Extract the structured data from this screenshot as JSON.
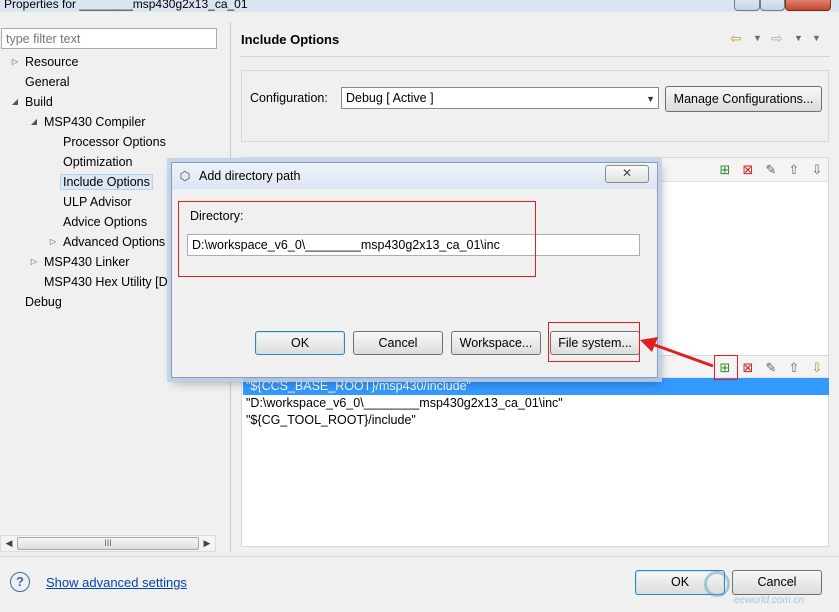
{
  "window": {
    "title": "Properties for ________msp430g2x13_ca_01"
  },
  "filter": {
    "placeholder": "type filter text"
  },
  "tree": {
    "items": [
      {
        "label": "Resource"
      },
      {
        "label": "General"
      },
      {
        "label": "Build"
      },
      {
        "label": "MSP430 Compiler"
      },
      {
        "label": "Processor Options"
      },
      {
        "label": "Optimization"
      },
      {
        "label": "Include Options"
      },
      {
        "label": "ULP Advisor"
      },
      {
        "label": "Advice Options"
      },
      {
        "label": "Advanced Options"
      },
      {
        "label": "MSP430 Linker"
      },
      {
        "label": "MSP430 Hex Utility  [D"
      },
      {
        "label": "Debug"
      }
    ],
    "scroll_grip": "III"
  },
  "page": {
    "title": "Include Options",
    "configuration_label": "Configuration:",
    "configuration_value": "Debug  [ Active ]",
    "manage_configurations": "Manage Configurations..."
  },
  "include_paths": [
    "\"${CCS_BASE_ROOT}/msp430/include\"",
    "\"D:\\workspace_v6_0\\________msp430g2x13_ca_01\\inc\"",
    "\"${CG_TOOL_ROOT}/include\""
  ],
  "bottom": {
    "help_icon_glyph": "?",
    "show_advanced": "Show advanced settings",
    "ok": "OK",
    "cancel": "Cancel"
  },
  "watermark": {
    "url": "eeworld.com.cn"
  },
  "dialog": {
    "title": "Add directory path",
    "close_glyph": "✕",
    "directory_label": "Directory:",
    "directory_value": "D:\\workspace_v6_0\\________msp430g2x13_ca_01\\inc",
    "ok": "OK",
    "cancel": "Cancel",
    "workspace": "Workspace...",
    "file_system": "File system..."
  },
  "colors": {
    "selection": "#3399ff",
    "annotation_red": "#e02020",
    "link": "#0645ad"
  },
  "icons": {
    "add": "add-path-icon",
    "delete": "delete-path-icon",
    "edit": "edit-path-icon",
    "move_up": "move-up-icon",
    "move_down": "move-down-icon"
  }
}
